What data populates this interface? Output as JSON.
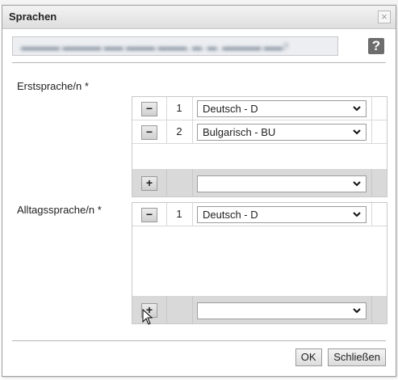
{
  "dialog": {
    "title": "Sprachen",
    "close_icon": "close-icon",
    "help_label": "?",
    "ok_label": "OK",
    "close_label": "Schließen"
  },
  "sections": {
    "first": {
      "label": "Erstsprache/n *",
      "rows": [
        {
          "index": "1",
          "value": "Deutsch - D"
        },
        {
          "index": "2",
          "value": "Bulgarisch - BU"
        }
      ],
      "add_value": ""
    },
    "daily": {
      "label": "Alltagssprache/n *",
      "rows": [
        {
          "index": "1",
          "value": "Deutsch - D"
        }
      ],
      "add_value": ""
    }
  },
  "glyphs": {
    "minus": "−",
    "plus": "+"
  }
}
